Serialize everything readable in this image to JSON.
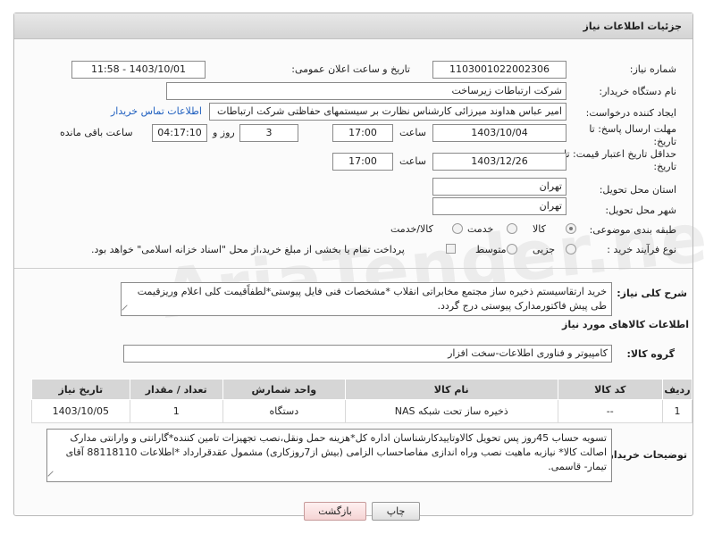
{
  "header": {
    "title": "جزئیات اطلاعات نیاز"
  },
  "fields": {
    "need_number_label": "شماره نیاز:",
    "need_number": "1103001022002306",
    "announce_label": "تاریخ و ساعت اعلان عمومی:",
    "announce_value": "1403/10/01 - 11:58",
    "buyer_org_label": "نام دستگاه خریدار:",
    "buyer_org": "شرکت ارتباطات زیرساخت",
    "creator_label": "ایجاد کننده درخواست:",
    "creator": "امیر عباس هداوند میرزائی کارشناس نظارت بر سیستمهای حفاظتی شرکت ارتباطات",
    "contact_link": "اطلاعات تماس خریدار",
    "deadline_label_1": "مهلت ارسال پاسخ: تا",
    "deadline_label_2": "تاریخ:",
    "deadline_date": "1403/10/04",
    "time_label": "ساعت",
    "deadline_time": "17:00",
    "days_value": "3",
    "days_label": "روز و",
    "remaining_time": "04:17:10",
    "remaining_label": "ساعت باقی مانده",
    "validity_label_1": "حداقل تاریخ اعتبار قیمت: تا",
    "validity_label_2": "تاریخ:",
    "validity_date": "1403/12/26",
    "validity_time": "17:00",
    "province_label": "استان محل تحویل:",
    "province": "تهران",
    "city_label": "شهر محل تحویل:",
    "city": "تهران",
    "category_label": "طبقه بندی موضوعی:",
    "category_options": [
      "کالا",
      "خدمت",
      "کالا/خدمت"
    ],
    "process_label": "نوع فرآیند خرید :",
    "process_options": [
      "جزیی",
      "متوسط"
    ],
    "payment_note": "پرداخت تمام یا بخشی از مبلغ خرید،از محل \"اسناد خزانه اسلامی\" خواهد بود.",
    "description_label": "شرح کلی نیاز:",
    "description": "خرید ارتقاسیستم ذخیره ساز مجتمع مخابراتی انقلاب *مشخصات فنی فایل پیوستی*لطفاًقیمت کلی اعلام وریزقیمت طی پیش فاکتورمدارک پیوستی درج گردد."
  },
  "goods": {
    "section_title": "اطلاعات کالاهای مورد نیاز",
    "group_label": "گروه کالا:",
    "group_value": "کامپیوتر و فناوری اطلاعات-سخت افزار",
    "columns": [
      "ردیف",
      "کد کالا",
      "نام کالا",
      "واحد شمارش",
      "تعداد / مقدار",
      "تاریخ نیاز"
    ],
    "rows": [
      [
        "1",
        "--",
        "ذخیره ساز تحت شبکه NAS",
        "دستگاه",
        "1",
        "1403/10/05"
      ]
    ]
  },
  "buyer_notes": {
    "label": "توضیحات خریدار:",
    "text": "تسویه حساب 45روز پس تحویل کالاوتاییدکارشناسان اداره کل*هزینه حمل ونقل،نصب تجهیزات تامین کننده*گارانتی و وارانتی مدارک اصالت کالا* نیازبه ماهیت نصب وراه اندازی مفاصاحساب الزامی (بیش از7روزکاری) مشمول عقدقرارداد *اطلاعات 88118110 آقای تیمار- قاسمی."
  },
  "buttons": {
    "print": "چاپ",
    "back": "بازگشت"
  },
  "watermark": "AriaTender.neT",
  "colors": {
    "link": "#1f5fbf",
    "header_bg": "#d9d9d9",
    "table_header": "#d6d6d6"
  }
}
